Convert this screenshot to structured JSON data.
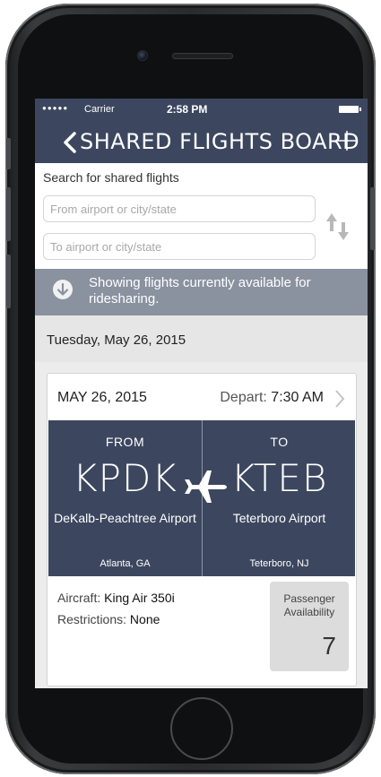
{
  "status_bar": {
    "signal": "●●●●●",
    "carrier": "Carrier",
    "time": "2:58 PM"
  },
  "nav": {
    "title": "SHARED FLIGHTS BOARD",
    "back_icon": "chevron-left-icon",
    "add_icon": "plus-icon"
  },
  "search": {
    "label": "Search for shared flights",
    "from_placeholder": "From airport or city/state",
    "to_placeholder": "To airport or city/state",
    "from_value": "",
    "to_value": "",
    "swap_icon": "swap-arrows-icon"
  },
  "banner": {
    "icon": "arrow-down-circle-icon",
    "text": "Showing flights currently available for ridesharing."
  },
  "date_header": "Tuesday, May 26, 2015",
  "flight": {
    "date": "MAY 26, 2015",
    "depart_label": "Depart:",
    "depart_time": "7:30 AM",
    "from_label": "FROM",
    "to_label": "TO",
    "from_code": "KPDK",
    "to_code": "KTEB",
    "from_name": "DeKalb-Peachtree Airport",
    "to_name": "Teterboro Airport",
    "from_city": "Atlanta, GA",
    "to_city": "Teterboro, NJ",
    "aircraft_label": "Aircraft:",
    "aircraft_value": "King Air 350i",
    "restrictions_label": "Restrictions:",
    "restrictions_value": "None",
    "availability_label": "Passenger Availability",
    "availability_value": "7"
  },
  "colors": {
    "navy": "#3c475f",
    "banner": "#8a919f",
    "background": "#ececec"
  }
}
